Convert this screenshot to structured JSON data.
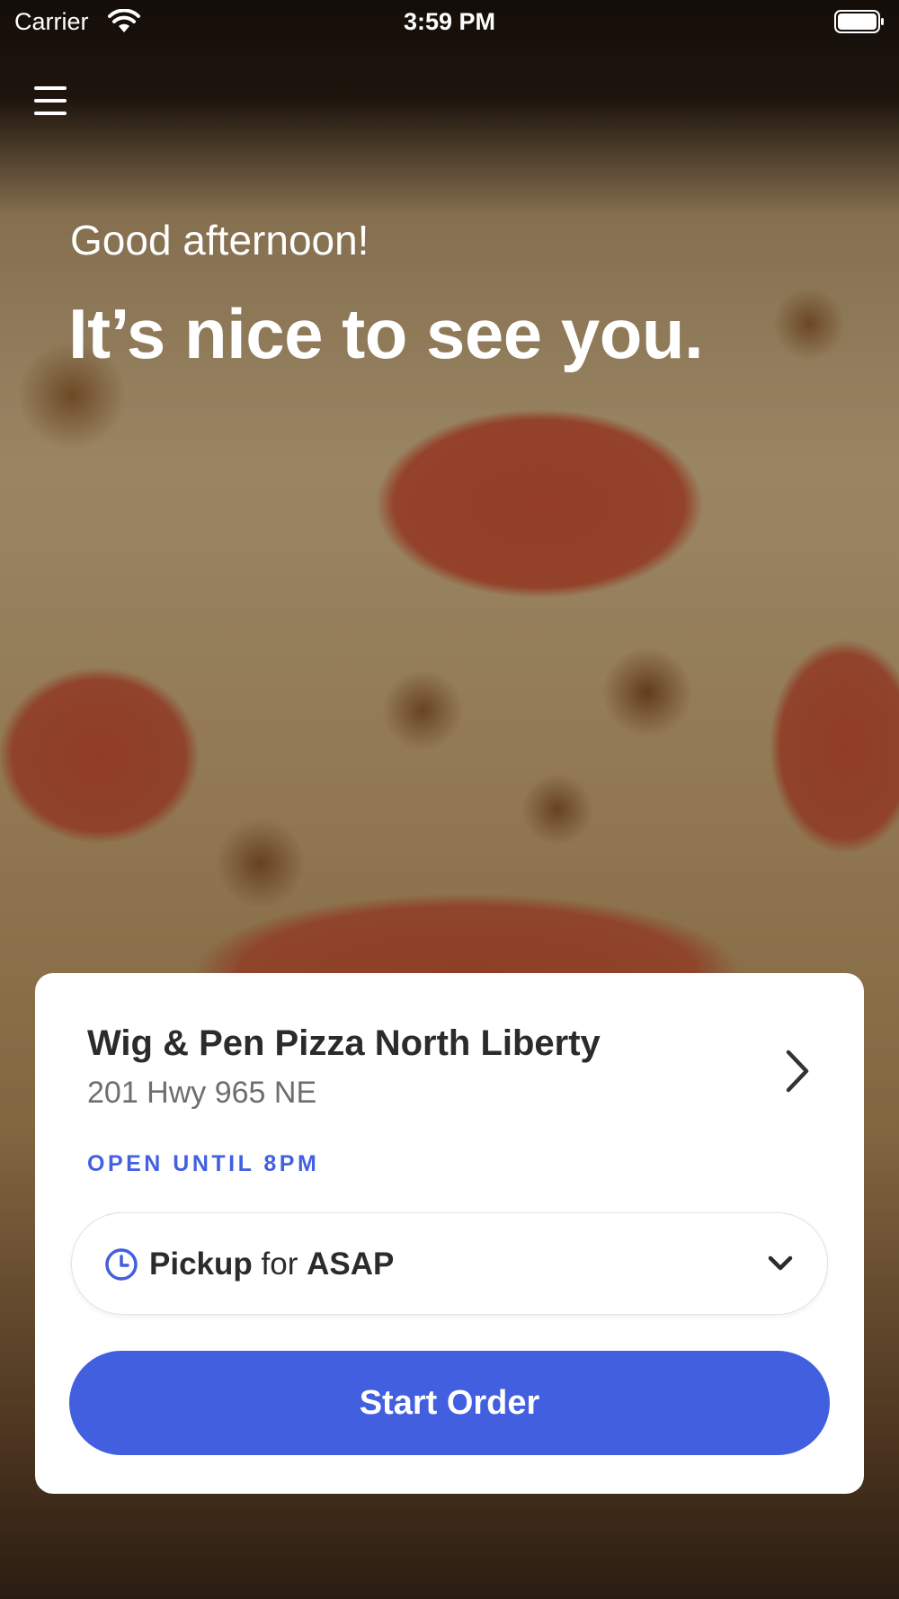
{
  "status_bar": {
    "carrier": "Carrier",
    "time": "3:59 PM"
  },
  "hero": {
    "greeting": "Good afternoon!",
    "headline": "It’s nice to see you."
  },
  "store_card": {
    "name": "Wig & Pen Pizza North Liberty",
    "address": "201 Hwy 965 NE",
    "hours": "OPEN UNTIL 8PM",
    "order_mode": {
      "mode": "Pickup",
      "connector": "for",
      "time": "ASAP"
    },
    "start_order_label": "Start Order"
  },
  "icons": [
    "wifi-icon",
    "battery-icon",
    "menu-icon",
    "chevron-right-icon",
    "clock-icon",
    "chevron-down-icon"
  ],
  "colors": {
    "accent": "#415fdf",
    "text_primary": "#2b2b2b",
    "text_secondary": "#6e6e6e",
    "card_background": "#ffffff"
  }
}
